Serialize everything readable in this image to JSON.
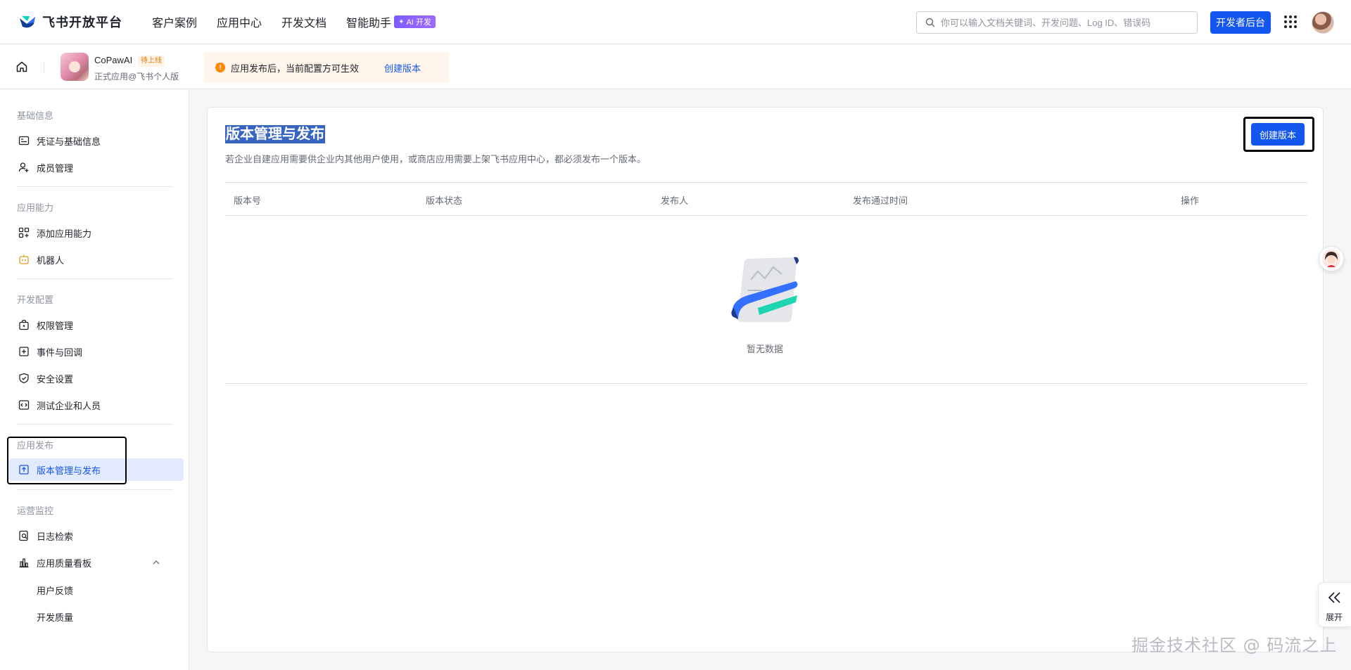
{
  "topnav": {
    "brand": "飞书开放平台",
    "links": [
      "客户案例",
      "应用中心",
      "开发文档",
      "智能助手"
    ],
    "ai_badge": "AI 开发",
    "search_placeholder": "你可以输入文档关键词、开发问题、Log ID、错误码",
    "dev_console": "开发者后台"
  },
  "app": {
    "name": "CoPawAI",
    "status": "待上线",
    "type": "正式应用@飞书个人版",
    "notice": "应用发布后，当前配置方可生效",
    "notice_link": "创建版本"
  },
  "sidebar": {
    "groups": [
      {
        "title": "基础信息",
        "items": [
          "凭证与基础信息",
          "成员管理"
        ]
      },
      {
        "title": "应用能力",
        "items": [
          "添加应用能力",
          "机器人"
        ]
      },
      {
        "title": "开发配置",
        "items": [
          "权限管理",
          "事件与回调",
          "安全设置",
          "测试企业和人员"
        ]
      },
      {
        "title": "应用发布",
        "items": [
          "版本管理与发布"
        ]
      },
      {
        "title": "运营监控",
        "items": [
          "日志检索",
          "应用质量看板"
        ]
      }
    ],
    "sub_items": [
      "用户反馈",
      "开发质量"
    ],
    "active_item": "版本管理与发布"
  },
  "main": {
    "title": "版本管理与发布",
    "description": "若企业自建应用需要供企业内其他用户使用，或商店应用需要上架飞书应用中心，都必须发布一个版本。",
    "create_button": "创建版本",
    "columns": [
      "版本号",
      "版本状态",
      "发布人",
      "发布通过时间",
      "操作"
    ],
    "empty_text": "暂无数据"
  },
  "right_panel": {
    "expand_label": "展开"
  },
  "watermark": "掘金技术社区 @ 码流之上",
  "colors": {
    "primary": "#1456f0",
    "active_bg": "#e1eaff",
    "warning": "#ff8800",
    "notice_bg": "#fff5eb"
  }
}
